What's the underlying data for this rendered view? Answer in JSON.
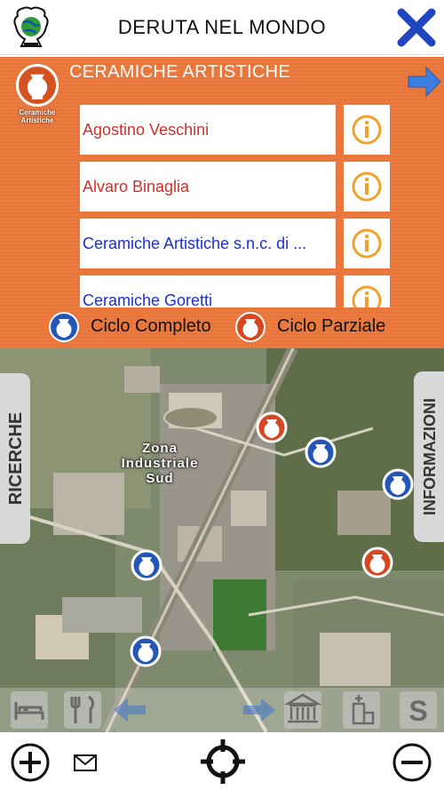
{
  "header": {
    "title": "DERUTA NEL MONDO",
    "logo_icon": "globe-vase-logo",
    "close_icon": "close-x-icon"
  },
  "panel": {
    "category_title": "CERAMICHE ARTISTICHE",
    "category_caption": "Ceramiche Artistiche",
    "category_icon": "vase-icon",
    "next_icon": "arrow-right-icon",
    "items": [
      {
        "name": "Agostino Veschini",
        "color": "#d0302a"
      },
      {
        "name": "Alvaro Binaglia",
        "color": "#d0302a"
      },
      {
        "name": "Ceramiche Artistiche s.n.c. di ...",
        "color": "#1a2fd0"
      },
      {
        "name": "Ceramiche Goretti",
        "color": "#1a2fd0"
      }
    ],
    "info_icon": "info-circle-icon",
    "legend": {
      "complete_label": "Ciclo Completo",
      "partial_label": "Ciclo Parziale",
      "complete_color": "#2456b8",
      "partial_color": "#d8461f"
    }
  },
  "map": {
    "label_line1": "Zona",
    "label_line2": "Industriale",
    "label_line3": "Sud",
    "left_tab": "RICERCHE",
    "right_tab": "INFORMAZIONI",
    "toolbar": [
      "bed-icon",
      "fork-knife-icon",
      "arrow-left-icon",
      "arrow-right-icon",
      "museum-icon",
      "church-icon",
      "s-icon"
    ]
  },
  "bottom": {
    "zoom_in_icon": "zoom-in-icon",
    "mail_icon": "mail-icon",
    "locate_icon": "crosshair-icon",
    "zoom_out_icon": "zoom-out-icon"
  },
  "colors": {
    "panel_orange": "#e8763a",
    "accent_blue": "#2d50c8",
    "info_orange": "#f2a22c"
  }
}
